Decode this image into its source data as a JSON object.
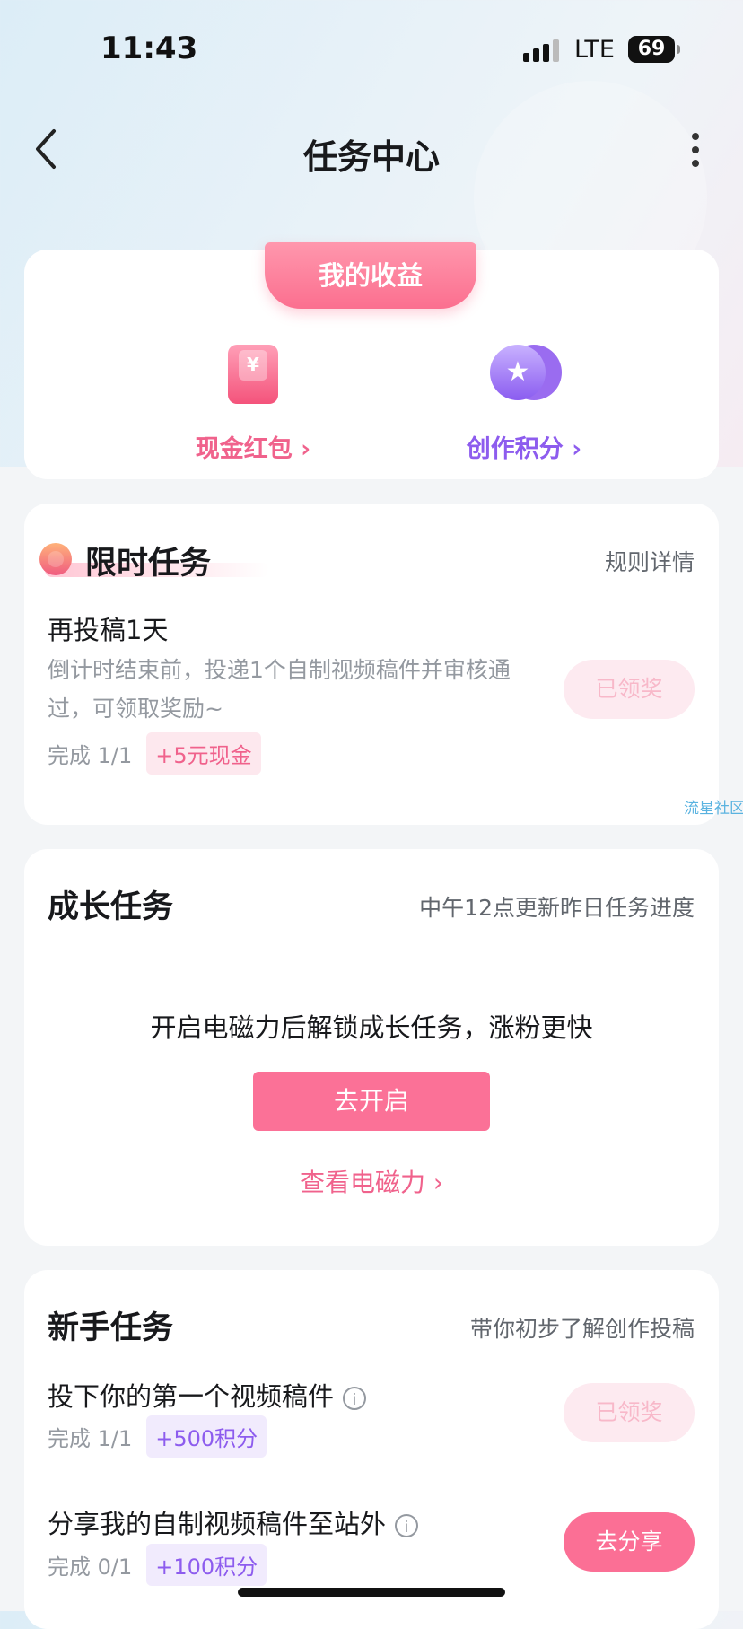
{
  "status_bar": {
    "time": "11:43",
    "network": "LTE",
    "battery": "69"
  },
  "nav": {
    "title": "任务中心"
  },
  "earnings": {
    "tab_label": "我的收益",
    "cash_label": "现金红包 ›",
    "cash_icon_glyph": "¥",
    "points_label": "创作积分 ›",
    "points_icon_glyph": "★"
  },
  "limited": {
    "title": "限时任务",
    "rules_link": "规则详情",
    "task": {
      "title": "再投稿1天",
      "desc": "倒计时结束前，投递1个自制视频稿件并审核通过，可领取奖励~",
      "progress": "完成 1/1",
      "reward": "+5元现金",
      "button": "已领奖"
    }
  },
  "watermark": "流星社区",
  "growth": {
    "title": "成长任务",
    "note": "中午12点更新昨日任务进度",
    "message": "开启电磁力后解锁成长任务，涨粉更快",
    "open_button": "去开启",
    "view_link": "查看电磁力 ›"
  },
  "newbie": {
    "title": "新手任务",
    "note": "带你初步了解创作投稿",
    "tasks": [
      {
        "title": "投下你的第一个视频稿件",
        "progress": "完成 1/1",
        "reward": "+500积分",
        "button": "已领奖",
        "info": "i"
      },
      {
        "title": "分享我的自制视频稿件至站外",
        "progress": "完成 0/1",
        "reward": "+100积分",
        "button": "去分享",
        "info": "i"
      }
    ]
  }
}
